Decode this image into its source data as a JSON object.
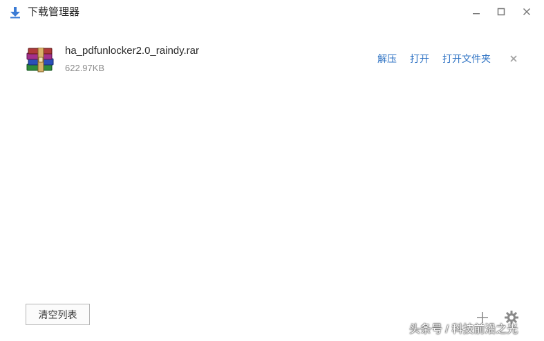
{
  "window": {
    "title": "下载管理器",
    "icons": {
      "app": "download-arrow-icon",
      "minimize": "minimize-icon",
      "maximize": "maximize-icon",
      "close": "close-icon"
    }
  },
  "downloads": [
    {
      "file_name": "ha_pdfunlocker2.0_raindy.rar",
      "file_size": "622.97KB",
      "file_icon": "winrar-archive-icon",
      "actions": {
        "extract": "解压",
        "open": "打开",
        "open_folder": "打开文件夹"
      },
      "remove_icon": "close-icon"
    }
  ],
  "footer": {
    "clear_list_label": "清空列表",
    "add_icon": "plus-icon",
    "settings_icon": "gear-icon"
  },
  "watermark": "头条号 / 科技前沿之光",
  "colors": {
    "accent": "#2f73c4",
    "icon_blue": "#3a7bd5",
    "text": "#2b2b2b",
    "muted": "#8c8c8c"
  }
}
